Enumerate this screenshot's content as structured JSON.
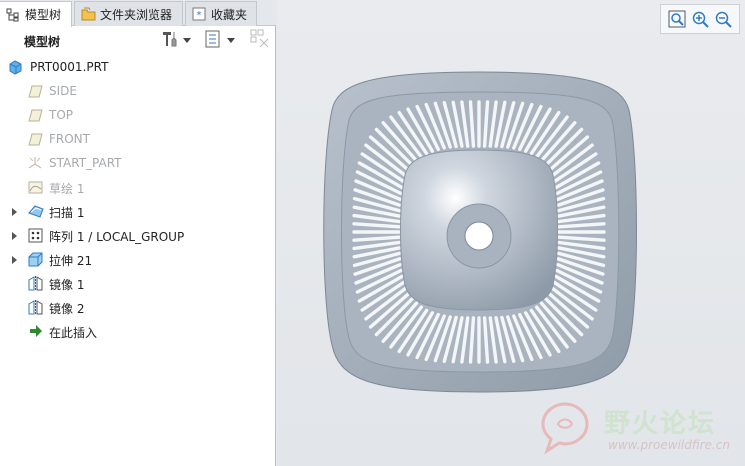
{
  "tabs": [
    {
      "label": "模型树"
    },
    {
      "label": "文件夹浏览器"
    },
    {
      "label": "收藏夹"
    }
  ],
  "model_tree_toolbar": {
    "title": "模型树"
  },
  "tree": {
    "root": "PRT0001.PRT",
    "items": [
      {
        "label": "SIDE"
      },
      {
        "label": "TOP"
      },
      {
        "label": "FRONT"
      },
      {
        "label": "START_PART"
      },
      {
        "label": "草绘 1"
      },
      {
        "label": "扫描 1"
      },
      {
        "label": "阵列 1 / LOCAL_GROUP"
      },
      {
        "label": "拉伸 21"
      },
      {
        "label": "镜像 1"
      },
      {
        "label": "镜像 2"
      },
      {
        "label": "在此插入"
      }
    ]
  },
  "watermark": {
    "title": "野火论坛",
    "url": "www.proewildfire.cn"
  },
  "colors": {
    "accent_blue": "#2e7bc4",
    "insert_arrow": "#2f8a2f",
    "dim_text": "#a6a9ad",
    "model_body": "#9aa6b2"
  }
}
